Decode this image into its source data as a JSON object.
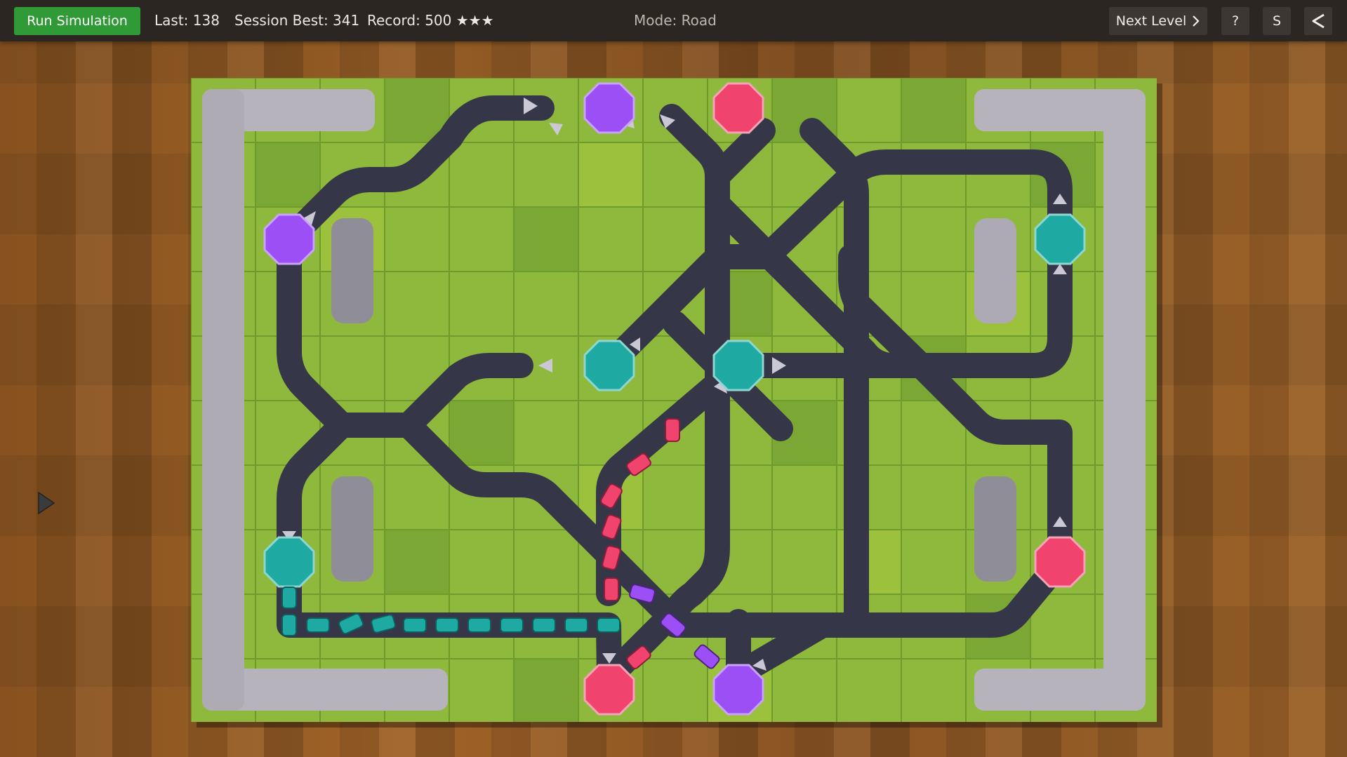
{
  "toolbar": {
    "run_label": "Run Simulation",
    "last_label": "Last: 138",
    "session_best_label": "Session Best: 341",
    "record_label": "Record: 500 ★★★",
    "mode_label": "Mode: Road",
    "next_level_label": "Next Level",
    "help_label": "?",
    "s_label": "S"
  },
  "icons": {
    "next": "chevron-right-icon",
    "share": "share-icon",
    "cursor": "triangle-pointer-icon"
  },
  "colors": {
    "run_button": "#2f9a36",
    "purple_station": "#9c4ff5",
    "pink_station": "#f0436d",
    "teal_station": "#1eaaa3",
    "road": "#353748",
    "grass": "#8fb93c"
  }
}
